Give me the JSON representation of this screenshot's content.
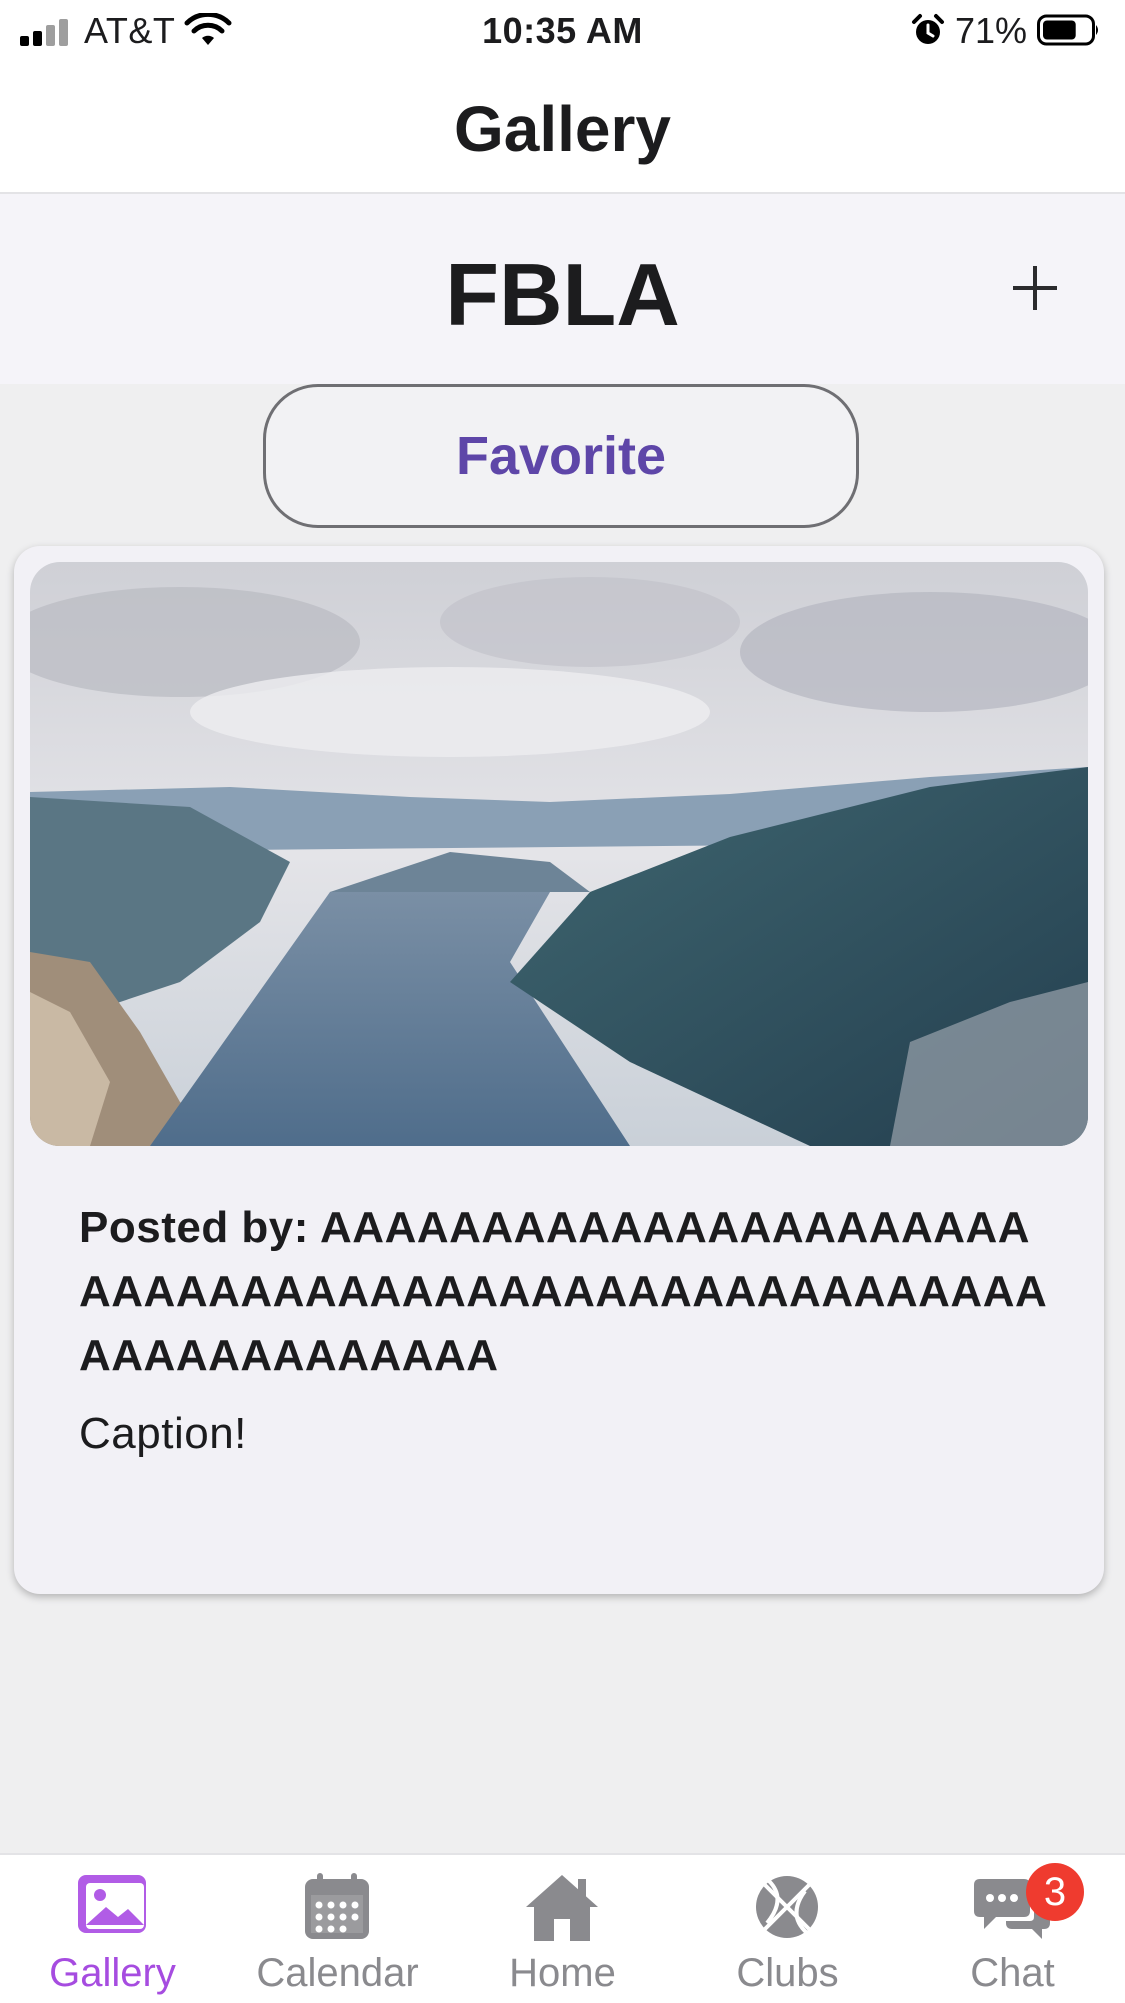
{
  "status_bar": {
    "carrier": "AT&T",
    "time": "10:35 AM",
    "battery_percent": "71%",
    "battery_level": 0.71,
    "signal_bars_filled": 2,
    "signal_bars_total": 4
  },
  "nav": {
    "title": "Gallery"
  },
  "club": {
    "name": "FBLA"
  },
  "favorite_button": {
    "label": "Favorite",
    "color": "#5e46a8"
  },
  "post": {
    "image_icon": "landscape-photo",
    "posted_by_label": "Posted by:",
    "author": "AAAAAAAAAAAAAAAAAAAAAAAAAAAAAAAAAAAAAAAAAAAAAAAAAAAAAAAAAAAAAAAAA",
    "caption": "Caption!"
  },
  "tab_bar": {
    "active_color": "#a64ce0",
    "inactive_color": "#8a8a8e",
    "tabs": [
      {
        "label": "Gallery",
        "icon": "photo-icon",
        "active": true
      },
      {
        "label": "Calendar",
        "icon": "calendar-icon",
        "active": false
      },
      {
        "label": "Home",
        "icon": "home-icon",
        "active": false
      },
      {
        "label": "Clubs",
        "icon": "basketball-icon",
        "active": false
      },
      {
        "label": "Chat",
        "icon": "chat-bubbles-icon",
        "active": false,
        "badge": "3"
      }
    ]
  }
}
